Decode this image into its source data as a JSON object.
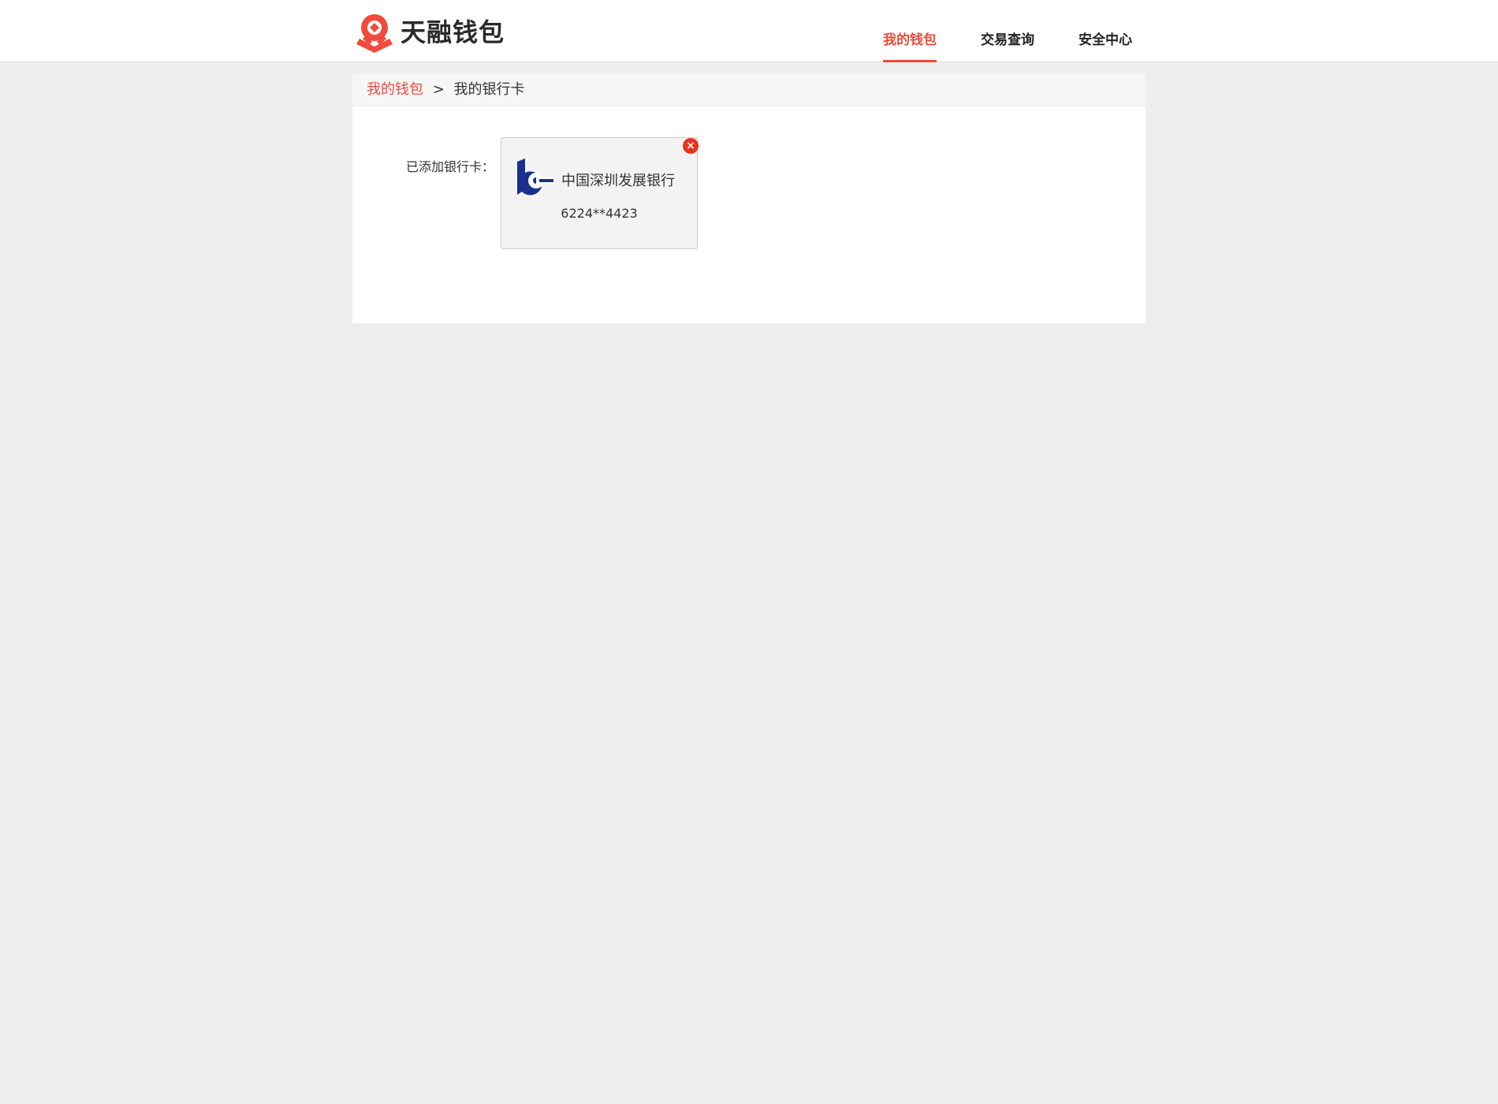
{
  "header": {
    "logo_text": "天融钱包",
    "logo_icon": "wallet-logo-icon",
    "nav": [
      {
        "label": "我的钱包",
        "active": true
      },
      {
        "label": "交易查询",
        "active": false
      },
      {
        "label": "安全中心",
        "active": false
      }
    ]
  },
  "breadcrumb": {
    "root": "我的钱包",
    "separator": ">",
    "current": "我的银行卡"
  },
  "cards_section": {
    "label": "已添加银行卡：",
    "cards": [
      {
        "bank_name": "中国深圳发展银行",
        "number": "6224**4423",
        "logo_icon": "sdb-bank-logo-icon",
        "remove_icon": "close-icon",
        "remove_symbol": "×"
      }
    ]
  },
  "colors": {
    "accent": "#f04a3c",
    "bank_logo": "#1b2f8e",
    "remove_badge": "#e8321e",
    "page_bg": "#eeeeee"
  }
}
